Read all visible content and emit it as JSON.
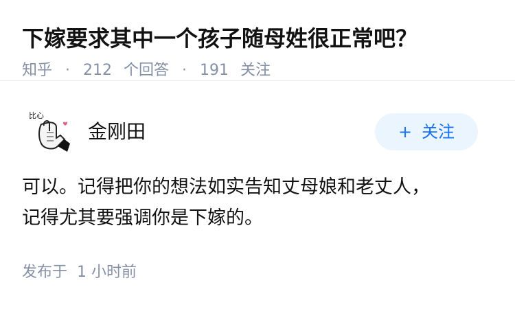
{
  "question": {
    "title": "下嫁要求其中一个孩子随母姓很正常吧？",
    "source": "知乎",
    "separator": "·",
    "answer_count": "212",
    "answer_label": "个回答",
    "follower_count": "191",
    "follower_label": "关注"
  },
  "answer": {
    "author": {
      "name": "金刚田",
      "avatar_icon": "finger-heart-hand-avatar",
      "avatar_text": "比心"
    },
    "follow_button": {
      "plus": "+",
      "label": "关注"
    },
    "content_lines": [
      "可以。记得把你的想法如实告知丈母娘和老丈人，",
      "记得尤其要强调你是下嫁的。"
    ],
    "time": {
      "label": "发布于",
      "value": "1 小时前"
    }
  },
  "colors": {
    "meta_gray": "#8590a6",
    "text": "#121212",
    "follow_bg": "#ebf5fd",
    "follow_text": "#1772f6",
    "divider": "#ebebeb"
  }
}
